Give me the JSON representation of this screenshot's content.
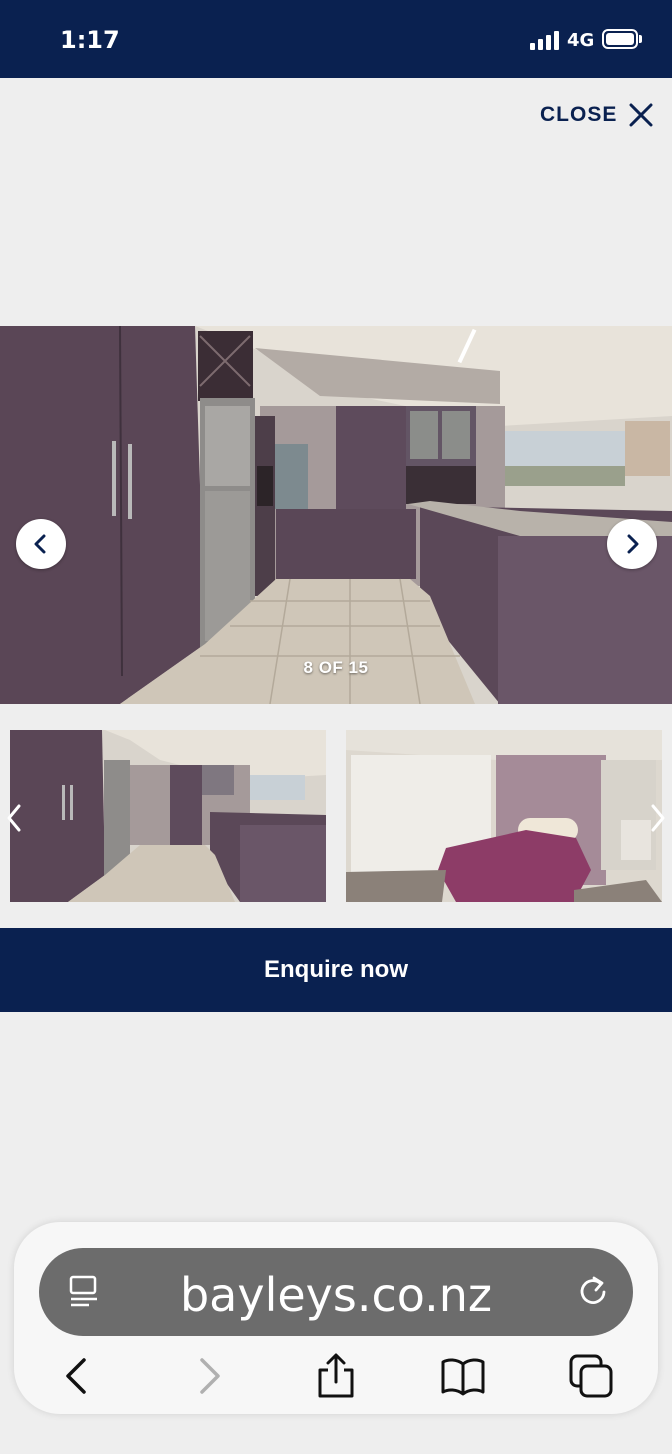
{
  "status": {
    "time": "1:17",
    "network": "4G"
  },
  "viewer": {
    "close_label": "CLOSE",
    "counter": "8 OF 15",
    "enquire_label": "Enquire now"
  },
  "browser": {
    "url": "bayleys.co.nz"
  },
  "colors": {
    "navy": "#0a2150",
    "background": "#eeeeee",
    "url_bar": "#6c6c6c"
  },
  "icons": [
    "close-icon",
    "chevron-left-icon",
    "chevron-right-icon",
    "reader-icon",
    "reload-icon",
    "back-icon",
    "forward-icon",
    "share-icon",
    "bookmarks-icon",
    "tabs-icon"
  ]
}
